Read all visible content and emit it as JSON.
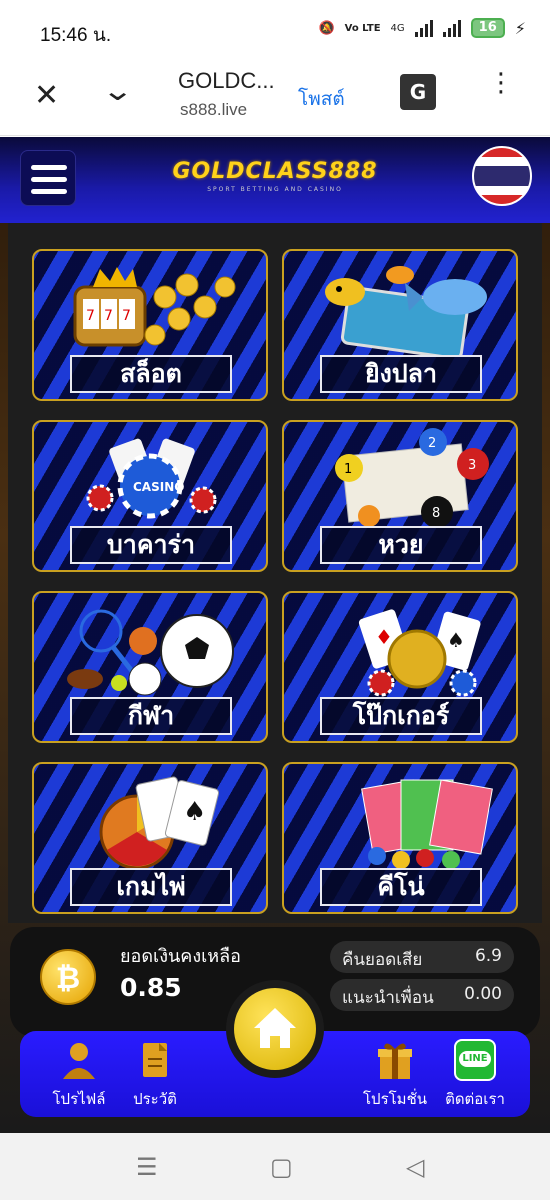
{
  "status_bar": {
    "time": "15:46 น.",
    "network": "Vo LTE",
    "network_speed": "4G",
    "battery": "16"
  },
  "browser": {
    "close_icon": "close-icon",
    "title": "GOLDC...",
    "url": "s888.live",
    "post_label": "โพสต์",
    "translate_label": "G"
  },
  "site": {
    "logo_text": "GOLDCLASS888",
    "logo_tagline": "SPORT BETTING AND CASINO"
  },
  "games": [
    {
      "label": "สล็อต",
      "icon": "slot-machine-icon"
    },
    {
      "label": "ยิงปลา",
      "icon": "fish-shooting-icon"
    },
    {
      "label": "บาคาร่า",
      "icon": "casino-chips-icon"
    },
    {
      "label": "หวย",
      "icon": "lottery-balls-icon"
    },
    {
      "label": "กีฬา",
      "icon": "sports-balls-icon"
    },
    {
      "label": "โป๊กเกอร์",
      "icon": "poker-cards-icon"
    },
    {
      "label": "เกมไพ่",
      "icon": "card-game-icon"
    },
    {
      "label": "คีโน่",
      "icon": "bingo-icon"
    }
  ],
  "balance": {
    "label": "ยอดเงินคงเหลือ",
    "value": "0.85",
    "cashback_label": "คืนยอดเสีย",
    "cashback_value": "6.9",
    "referral_label": "แนะนำเพื่อน",
    "referral_value": "0.00"
  },
  "nav": {
    "profile": "โปรไฟล์",
    "history": "ประวัติ",
    "promotion": "โปรโมชั่น",
    "contact": "ติดต่อเรา",
    "line_badge": "LINE"
  },
  "colors": {
    "accent_gold": "#ffd21a",
    "nav_blue": "#2a1cff",
    "tile_border": "#c9a020"
  }
}
